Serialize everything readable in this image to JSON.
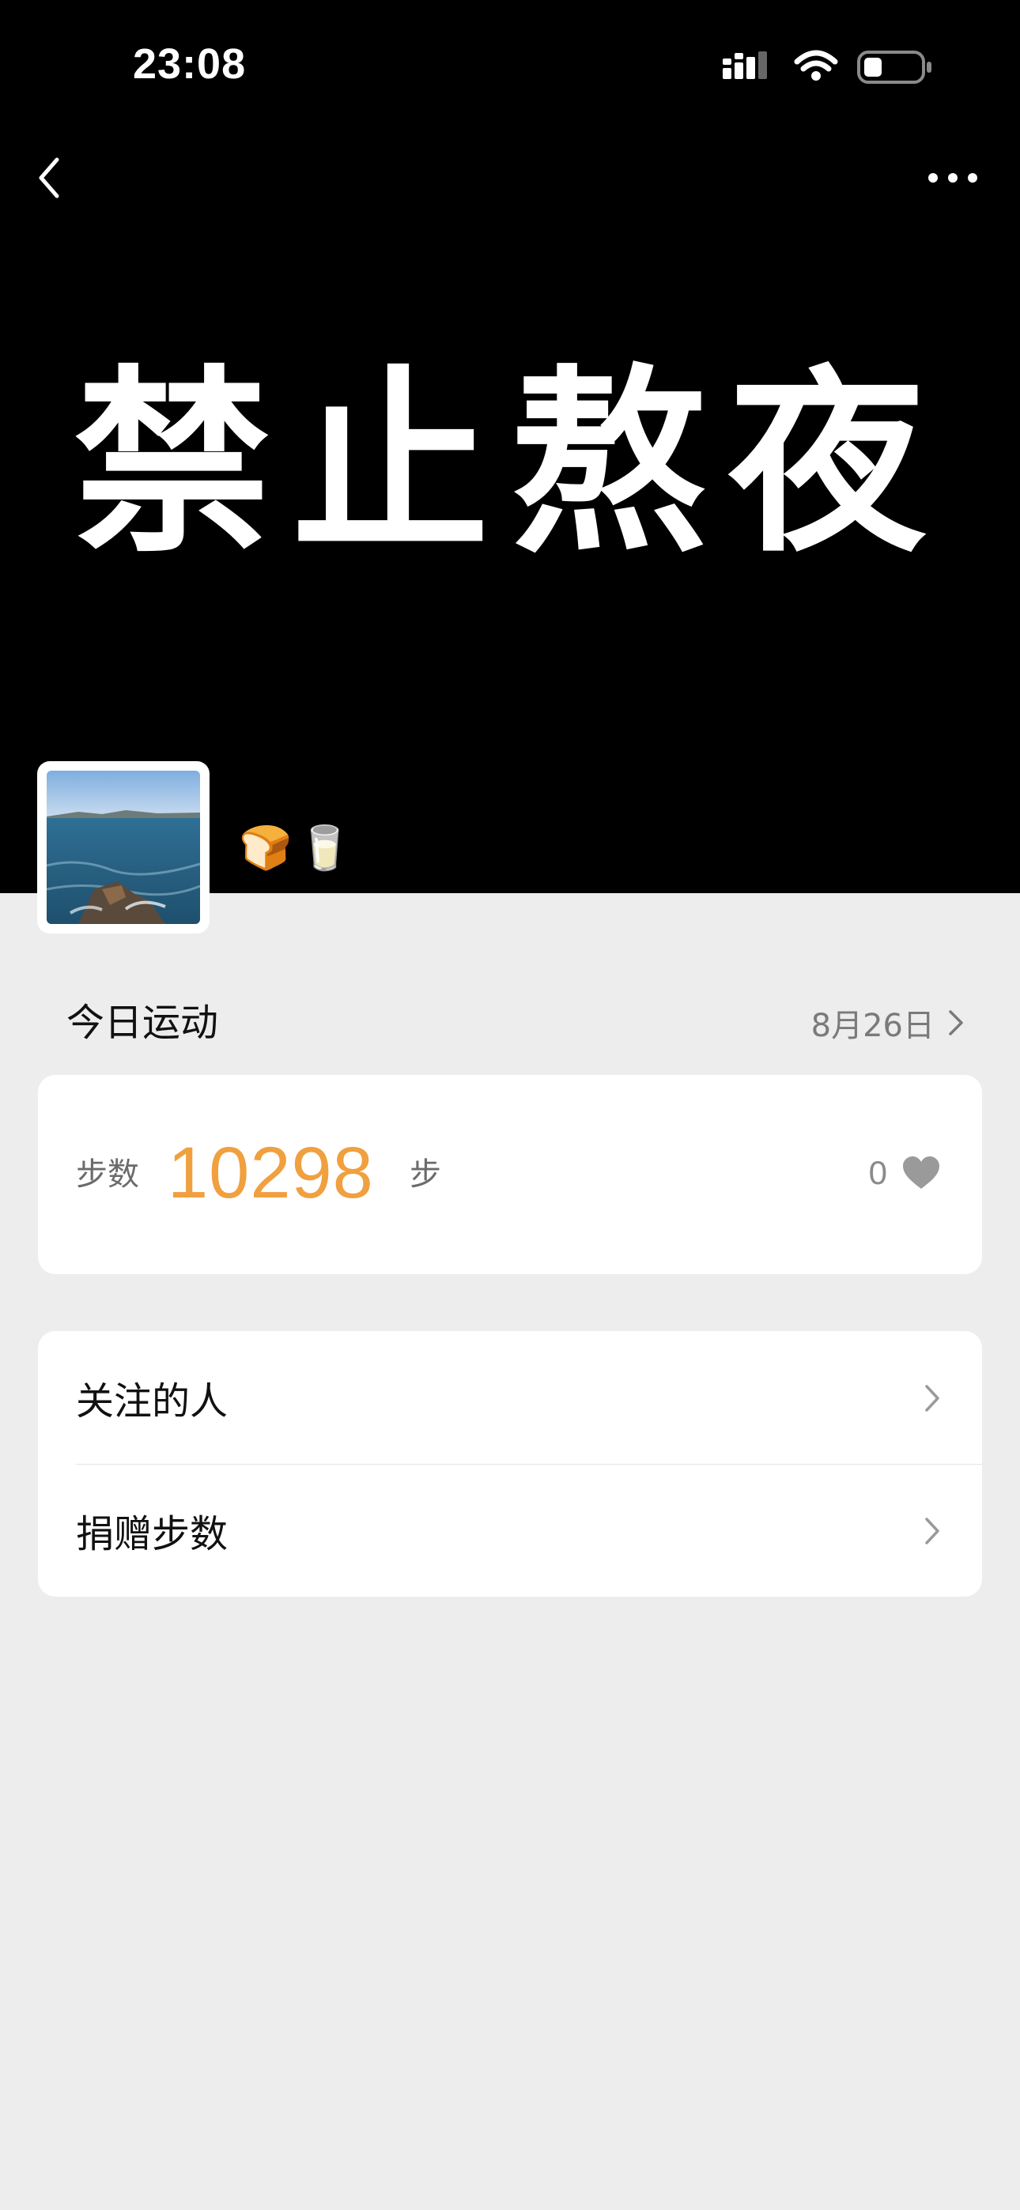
{
  "status_bar": {
    "time": "23:08",
    "icons": [
      "signal-icon",
      "wifi-icon",
      "battery-icon"
    ]
  },
  "nav": {
    "back_icon": "chevron-left-icon",
    "more_icon": "more-horizontal-icon"
  },
  "cover": {
    "text": "禁止熬夜",
    "background": "#000000"
  },
  "profile": {
    "avatar": "ocean-photo-avatar",
    "status_emoji": "🍞🥛"
  },
  "today": {
    "title": "今日运动",
    "date": "8月26日",
    "steps_label": "步数",
    "steps_value": "10298",
    "steps_unit": "步",
    "likes_count": "0",
    "accent_color": "#f0a03e"
  },
  "list": {
    "items": [
      {
        "label": "关注的人"
      },
      {
        "label": "捐赠步数"
      }
    ]
  }
}
